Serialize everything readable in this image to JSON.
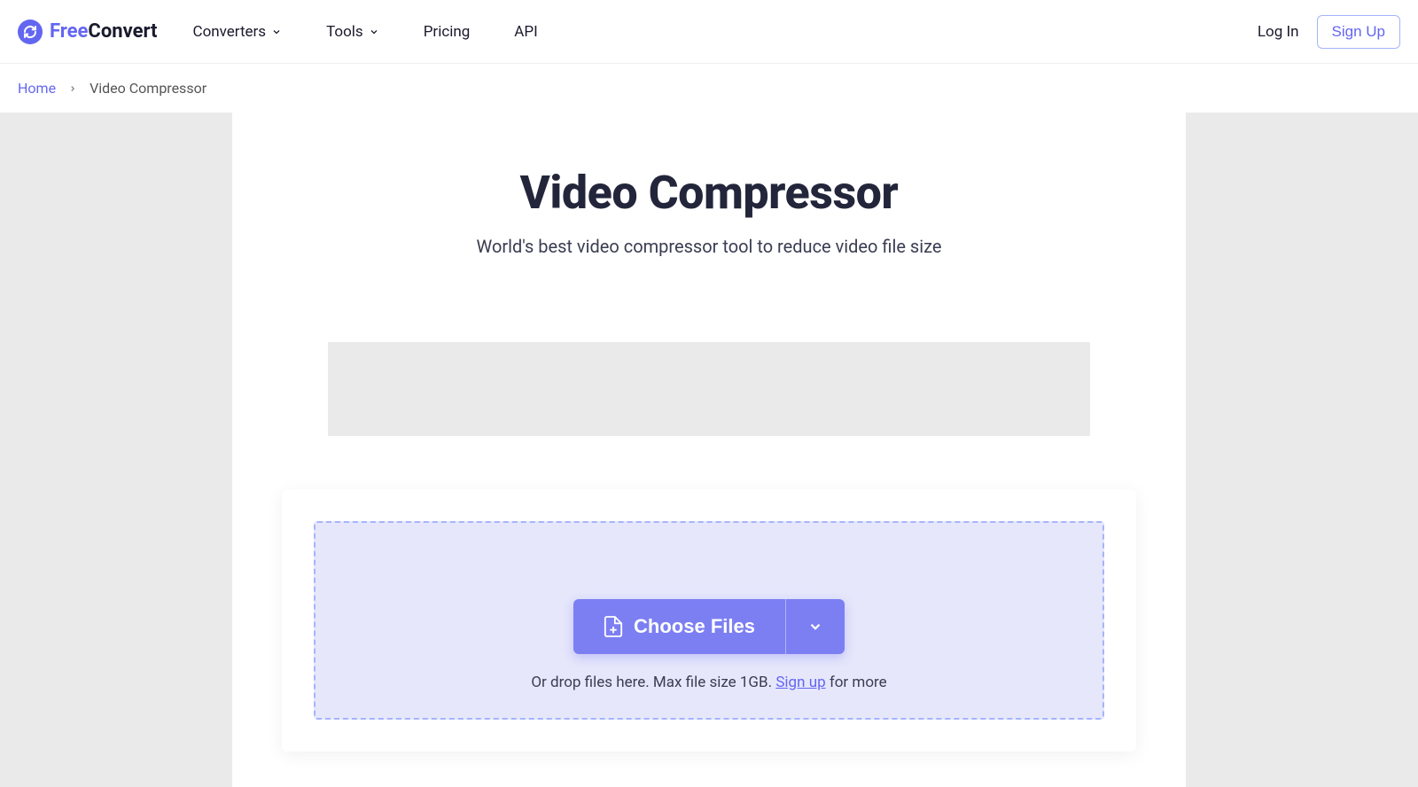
{
  "header": {
    "logo": {
      "free": "Free",
      "convert": "Convert"
    },
    "nav": {
      "converters": "Converters",
      "tools": "Tools",
      "pricing": "Pricing",
      "api": "API"
    },
    "auth": {
      "login": "Log In",
      "signup": "Sign Up"
    }
  },
  "breadcrumb": {
    "home": "Home",
    "current": "Video Compressor"
  },
  "main": {
    "title": "Video Compressor",
    "subtitle": "World's best video compressor tool to reduce video file size",
    "choose_label": "Choose Files",
    "drop_prefix": "Or drop files here. Max file size 1GB. ",
    "drop_link": "Sign up",
    "drop_suffix": " for more"
  }
}
